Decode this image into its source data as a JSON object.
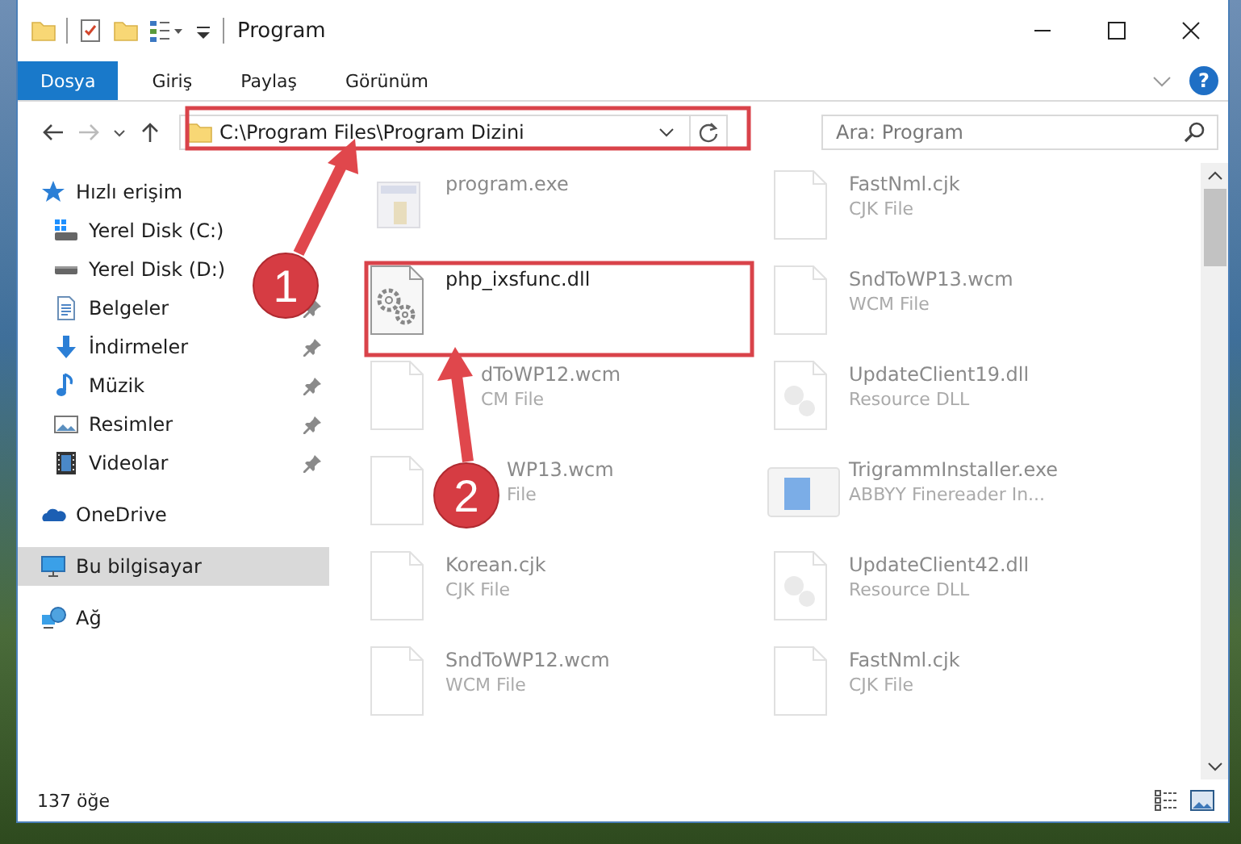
{
  "window": {
    "title": "Program"
  },
  "ribbon_tabs": [
    {
      "label": "Dosya",
      "kind": "file"
    },
    {
      "label": "Giriş",
      "kind": "tab"
    },
    {
      "label": "Paylaş",
      "kind": "tab"
    },
    {
      "label": "Görünüm",
      "kind": "tab"
    }
  ],
  "help": {
    "label": "?"
  },
  "address": {
    "path": "C:\\Program Files\\Program Dizini"
  },
  "search": {
    "placeholder": "Ara: Program"
  },
  "sidebar": {
    "items": [
      {
        "label": "Hızlı erişim",
        "kind": "star",
        "selected": false,
        "children": [
          {
            "label": "Yerel Disk (C:)",
            "kind": "drive-c",
            "selected": false
          },
          {
            "label": "Yerel Disk (D:)",
            "kind": "drive",
            "selected": false
          },
          {
            "label": "Belgeler",
            "kind": "documents",
            "selected": false,
            "pinned": true
          },
          {
            "label": "İndirmeler",
            "kind": "downloads",
            "selected": false,
            "pinned": true
          },
          {
            "label": "Müzik",
            "kind": "music",
            "selected": false,
            "pinned": true
          },
          {
            "label": "Resimler",
            "kind": "pictures",
            "selected": false,
            "pinned": true
          },
          {
            "label": "Videolar",
            "kind": "videos",
            "selected": false,
            "pinned": true
          }
        ]
      },
      {
        "label": "OneDrive",
        "kind": "cloud",
        "selected": false
      },
      {
        "label": "Bu bilgisayar",
        "kind": "computer",
        "selected": true
      },
      {
        "label": "Ağ",
        "kind": "network",
        "selected": false
      }
    ]
  },
  "files": [
    {
      "name": "program.exe",
      "kind": "exe",
      "faded": true
    },
    {
      "name": "FastNml.cjk",
      "type": "CJK File",
      "kind": "blank",
      "faded": true
    },
    {
      "name": "php_ixsfunc.dll",
      "kind": "gear",
      "faded": false
    },
    {
      "name": "SndToWP13.wcm",
      "type": "WCM File",
      "kind": "blank",
      "faded": true
    },
    {
      "name": "dToWP12.wcm",
      "type": "CM File",
      "kind": "blank",
      "faded": true,
      "under_arrow": true
    },
    {
      "name": "UpdateClient19.dll",
      "type": "Resource DLL",
      "kind": "resource",
      "faded": true
    },
    {
      "name": "WP13.wcm",
      "type": "File",
      "kind": "blank",
      "faded": true,
      "under_marker": true
    },
    {
      "name": "TrigrammInstaller.exe",
      "type": "ABBYY Finereader In...",
      "kind": "installer",
      "faded": true
    },
    {
      "name": "Korean.cjk",
      "type": "CJK File",
      "kind": "blank",
      "faded": true
    },
    {
      "name": "UpdateClient42.dll",
      "type": "Resource DLL",
      "kind": "resource",
      "faded": true
    },
    {
      "name": "SndToWP12.wcm",
      "type": "WCM File",
      "kind": "blank",
      "faded": true
    },
    {
      "name": "FastNml.cjk",
      "type": "CJK File",
      "kind": "blank",
      "faded": true
    }
  ],
  "status_bar": {
    "count": "137 öğe"
  },
  "annotations": [
    {
      "number": "1"
    },
    {
      "number": "2"
    }
  ]
}
